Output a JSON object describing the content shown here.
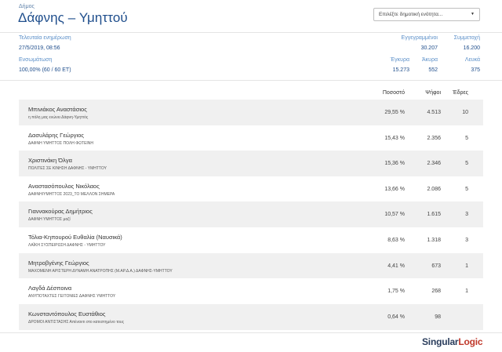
{
  "header": {
    "municipality_label": "Δήμος",
    "title": "Δάφνης – Υμηττού",
    "selector_placeholder": "Επιλέξτε δημοτική ενότητα..."
  },
  "stats": {
    "last_update_label": "Τελευταία ενημέρωση",
    "last_update_value": "27/5/2019, 08:56",
    "counted_label": "Ενσωμάτωση",
    "counted_value": "100,00% (60 / 60 ΕΤ)",
    "registered_label": "Εγγεγραμμένοι",
    "registered_value": "30.207",
    "turnout_label": "Συμμετοχή",
    "turnout_value": "16.200",
    "valid_label": "Έγκυρα",
    "valid_value": "15.273",
    "invalid_label": "Άκυρα",
    "invalid_value": "552",
    "blank_label": "Λευκά",
    "blank_value": "375"
  },
  "table": {
    "col_percent": "Ποσοστό",
    "col_votes": "Ψήφοι",
    "col_seats": "Έδρες",
    "rows": [
      {
        "name": "Μπινιάκος Αναστάσιος",
        "party": "η πόλη μας ενώνει Δάφνη-Υμηττός",
        "percent": "29,55 %",
        "votes": "4.513",
        "seats": "10"
      },
      {
        "name": "Δασυλάρης Γεώργιος",
        "party": "ΔΑΦΝΗ ΥΜΗΤΤΟΣ ΠΟΛΗ ΦΩΤΕΙΝΗ",
        "percent": "15,43 %",
        "votes": "2.356",
        "seats": "5"
      },
      {
        "name": "Χριστινάκη Όλγα",
        "party": "ΠΟΛΙΤΕΣ ΣΕ ΚΙΝΗΣΗ ΔΑΦΝΗΣ - ΥΜΗΤΤΟΥ",
        "percent": "15,36 %",
        "votes": "2.346",
        "seats": "5"
      },
      {
        "name": "Αναστασόπουλος Νικόλαος",
        "party": "ΔΑΦΝΗ/ΥΜΗΤΤΟΣ 2023_ΤΟ ΜΕΛΛΟΝ ΣΗΜΕΡΑ",
        "percent": "13,66 %",
        "votes": "2.086",
        "seats": "5"
      },
      {
        "name": "Γιαννακούρας Δημήτριος",
        "party": "ΔΑΦΝΗ ΥΜΗΤΤΟΣ μαζί",
        "percent": "10,57 %",
        "votes": "1.615",
        "seats": "3"
      },
      {
        "name": "Τόλια-Κηπουρού Ευθαλία (Ναυσικά)",
        "party": "ΛΑΪΚΗ ΣΥΣΠΕΙΡΩΣΗ ΔΑΦΝΗΣ - ΥΜΗΤΤΟΥ",
        "percent": "8,63 %",
        "votes": "1.318",
        "seats": "3"
      },
      {
        "name": "Μητροβγένης Γεώργιος",
        "party": "ΜΑΧΟΜΕΝΗ ΑΡΙΣΤΕΡΗ ΔΥΝΑΜΗ ΑΝΑΤΡΟΠΗΣ (Μ.ΑΡ.Δ.Α.) ΔΑΦΝΗΣ-ΥΜΗΤΤΟΥ",
        "percent": "4,41 %",
        "votes": "673",
        "seats": "1"
      },
      {
        "name": "Λαγδά Δέσποινα",
        "party": "ΑΝΥΠΟΤΑΧΤΕΣ ΓΕΙΤΟΝΙΕΣ ΔΑΦΝΗΣ ΥΜΗΤΤΟΥ",
        "percent": "1,75 %",
        "votes": "268",
        "seats": "1"
      },
      {
        "name": "Κωνσταντόπουλος Ευστάθιος",
        "party": "ΔΡΟΜΟΙ ΑΝΤΙΣΤΑΣΗΣ Απέναντι στο κατεστημένο τους",
        "percent": "0,64 %",
        "votes": "98",
        "seats": ""
      }
    ]
  },
  "footer": {
    "logo_part1": "Singular",
    "logo_part2": "Logic"
  }
}
